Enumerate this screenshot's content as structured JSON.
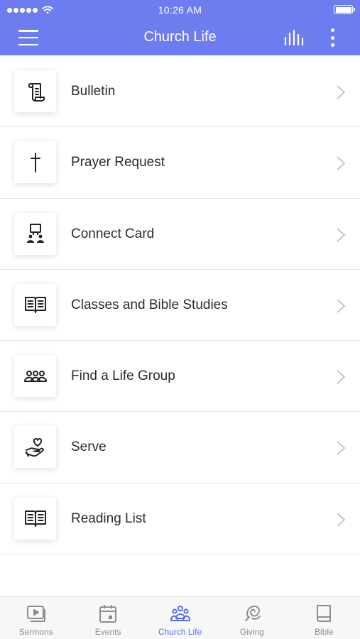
{
  "status_bar": {
    "time": "10:26 AM"
  },
  "header": {
    "title": "Church Life"
  },
  "list": [
    {
      "label": "Bulletin",
      "icon": "scroll-icon"
    },
    {
      "label": "Prayer Request",
      "icon": "cross-icon"
    },
    {
      "label": "Connect Card",
      "icon": "connect-card-icon"
    },
    {
      "label": "Classes and Bible Studies",
      "icon": "open-book-icon"
    },
    {
      "label": "Find a Life Group",
      "icon": "group-icon"
    },
    {
      "label": "Serve",
      "icon": "heart-hand-icon"
    },
    {
      "label": "Reading List",
      "icon": "open-book-icon"
    }
  ],
  "tabs": [
    {
      "label": "Sermons",
      "icon": "sermons-video-icon",
      "active": false
    },
    {
      "label": "Events",
      "icon": "calendar-icon",
      "active": false
    },
    {
      "label": "Church Life",
      "icon": "people-icon",
      "active": true
    },
    {
      "label": "Giving",
      "icon": "giving-icon",
      "active": false
    },
    {
      "label": "Bible",
      "icon": "bible-book-icon",
      "active": false
    }
  ],
  "colors": {
    "accent": "#6d7df0",
    "active_tab": "#5a6ee6",
    "inactive_tab": "#8e8e8e"
  }
}
